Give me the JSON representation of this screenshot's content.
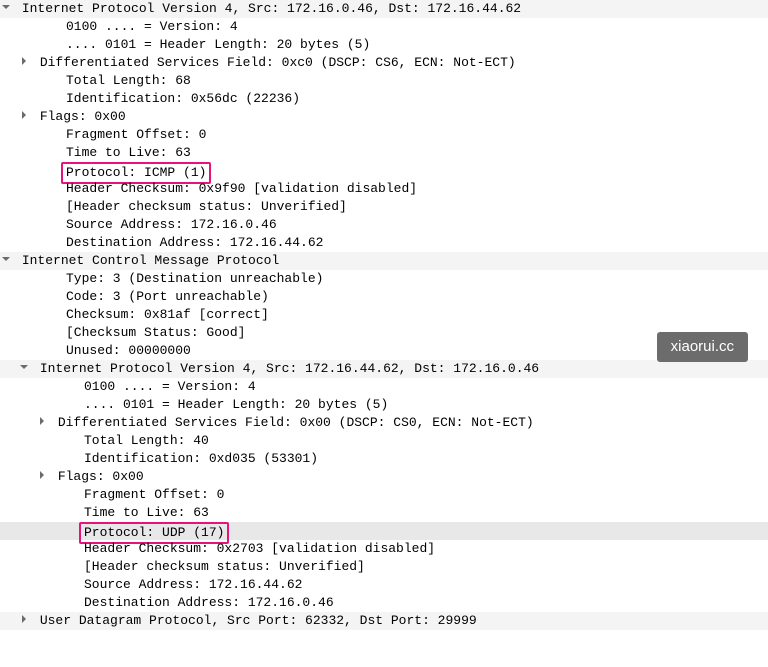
{
  "lines": [
    {
      "indent": 1,
      "arrow": "down",
      "text": "Internet Protocol Version 4, Src: 172.16.0.46, Dst: 172.16.44.62",
      "bg": "light",
      "name": "ipv4-header-1"
    },
    {
      "indent": 3,
      "text": "0100 .... = Version: 4",
      "name": "version-1"
    },
    {
      "indent": 3,
      "text": ".... 0101 = Header Length: 20 bytes (5)",
      "name": "header-length-1"
    },
    {
      "indent": 2,
      "arrow": "right",
      "text": "Differentiated Services Field: 0xc0 (DSCP: CS6, ECN: Not-ECT)",
      "name": "dsf-1"
    },
    {
      "indent": 3,
      "text": "Total Length: 68",
      "name": "total-length-1"
    },
    {
      "indent": 3,
      "text": "Identification: 0x56dc (22236)",
      "name": "identification-1"
    },
    {
      "indent": 2,
      "arrow": "right",
      "text": "Flags: 0x00",
      "name": "flags-1"
    },
    {
      "indent": 3,
      "text": "Fragment Offset: 0",
      "name": "fragment-offset-1"
    },
    {
      "indent": 3,
      "text": "Time to Live: 63",
      "name": "ttl-1"
    },
    {
      "indent": 3,
      "text": "Protocol: ICMP (1)",
      "name": "protocol-icmp",
      "highlight": true
    },
    {
      "indent": 3,
      "text": "Header Checksum: 0x9f90 [validation disabled]",
      "name": "header-checksum-1"
    },
    {
      "indent": 3,
      "text": "[Header checksum status: Unverified]",
      "name": "header-checksum-status-1"
    },
    {
      "indent": 3,
      "text": "Source Address: 172.16.0.46",
      "name": "source-address-1"
    },
    {
      "indent": 3,
      "text": "Destination Address: 172.16.44.62",
      "name": "destination-address-1"
    },
    {
      "indent": 1,
      "arrow": "down",
      "text": "Internet Control Message Protocol",
      "bg": "light",
      "name": "icmp-header"
    },
    {
      "indent": 3,
      "text": "Type: 3 (Destination unreachable)",
      "name": "icmp-type"
    },
    {
      "indent": 3,
      "text": "Code: 3 (Port unreachable)",
      "name": "icmp-code"
    },
    {
      "indent": 3,
      "text": "Checksum: 0x81af [correct]",
      "name": "icmp-checksum"
    },
    {
      "indent": 3,
      "text": "[Checksum Status: Good]",
      "name": "icmp-checksum-status"
    },
    {
      "indent": 3,
      "text": "Unused: 00000000",
      "name": "icmp-unused"
    },
    {
      "indent": 2,
      "arrow": "down",
      "text": "Internet Protocol Version 4, Src: 172.16.44.62, Dst: 172.16.0.46",
      "bg": "light",
      "name": "ipv4-header-2"
    },
    {
      "indent": 4,
      "text": "0100 .... = Version: 4",
      "name": "version-2"
    },
    {
      "indent": 4,
      "text": ".... 0101 = Header Length: 20 bytes (5)",
      "name": "header-length-2"
    },
    {
      "indent": 3,
      "arrow": "right",
      "text": "Differentiated Services Field: 0x00 (DSCP: CS0, ECN: Not-ECT)",
      "name": "dsf-2"
    },
    {
      "indent": 4,
      "text": "Total Length: 40",
      "name": "total-length-2"
    },
    {
      "indent": 4,
      "text": "Identification: 0xd035 (53301)",
      "name": "identification-2"
    },
    {
      "indent": 3,
      "arrow": "right",
      "text": "Flags: 0x00",
      "name": "flags-2"
    },
    {
      "indent": 4,
      "text": "Fragment Offset: 0",
      "name": "fragment-offset-2"
    },
    {
      "indent": 4,
      "text": "Time to Live: 63",
      "name": "ttl-2"
    },
    {
      "indent": 4,
      "text": "Protocol: UDP (17)",
      "bg": "sel",
      "name": "protocol-udp",
      "highlight": true
    },
    {
      "indent": 4,
      "text": "Header Checksum: 0x2703 [validation disabled]",
      "name": "header-checksum-2"
    },
    {
      "indent": 4,
      "text": "[Header checksum status: Unverified]",
      "name": "header-checksum-status-2"
    },
    {
      "indent": 4,
      "text": "Source Address: 172.16.44.62",
      "name": "source-address-2"
    },
    {
      "indent": 4,
      "text": "Destination Address: 172.16.0.46",
      "name": "destination-address-2"
    },
    {
      "indent": 2,
      "arrow": "right",
      "text": "User Datagram Protocol, Src Port: 62332, Dst Port: 29999",
      "bg": "light",
      "name": "udp-header"
    }
  ],
  "watermark": "xiaorui.cc"
}
